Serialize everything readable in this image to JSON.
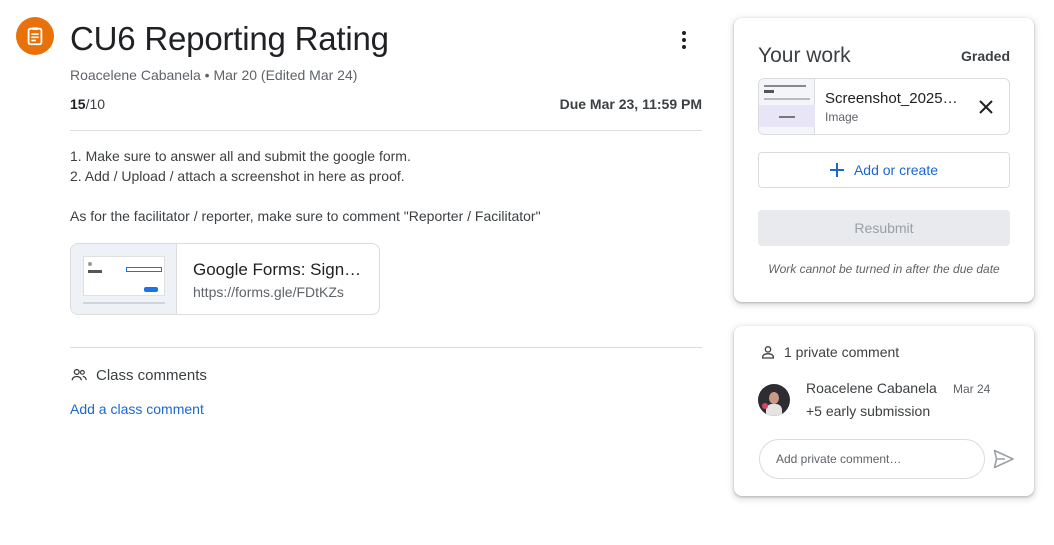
{
  "assignment": {
    "icon": "assignment-icon",
    "title": "CU6 Reporting Rating",
    "meta": "Roacelene Cabanela • Mar 20 (Edited Mar 24)",
    "points_earned": "15",
    "points_total": "/10",
    "due": "Due Mar 23, 11:59 PM",
    "instructions": [
      "1. Make sure to answer all and submit the google form.",
      "2. Add / Upload / attach a screenshot in here as proof.",
      "",
      "As for the facilitator / reporter, make sure to comment \"Reporter / Facilitator\""
    ],
    "link": {
      "title": "Google Forms: Sign…",
      "url": "https://forms.gle/FDtKZs"
    }
  },
  "class_comments": {
    "heading": "Class comments",
    "add_label": "Add a class comment"
  },
  "your_work": {
    "title": "Your work",
    "status": "Graded",
    "attachment": {
      "name": "Screenshot_2025…",
      "type": "Image"
    },
    "add_or_create": "Add or create",
    "resubmit": "Resubmit",
    "notice": "Work cannot be turned in after the due date"
  },
  "private_comments": {
    "heading": "1 private comment",
    "comments": [
      {
        "author": "Roacelene Cabanela",
        "date": "Mar 24",
        "text": "+5 early submission"
      }
    ],
    "input_placeholder": "Add private comment…"
  },
  "colors": {
    "accent": "#e8710a",
    "link": "#1967d2",
    "divider": "#dadce0"
  }
}
